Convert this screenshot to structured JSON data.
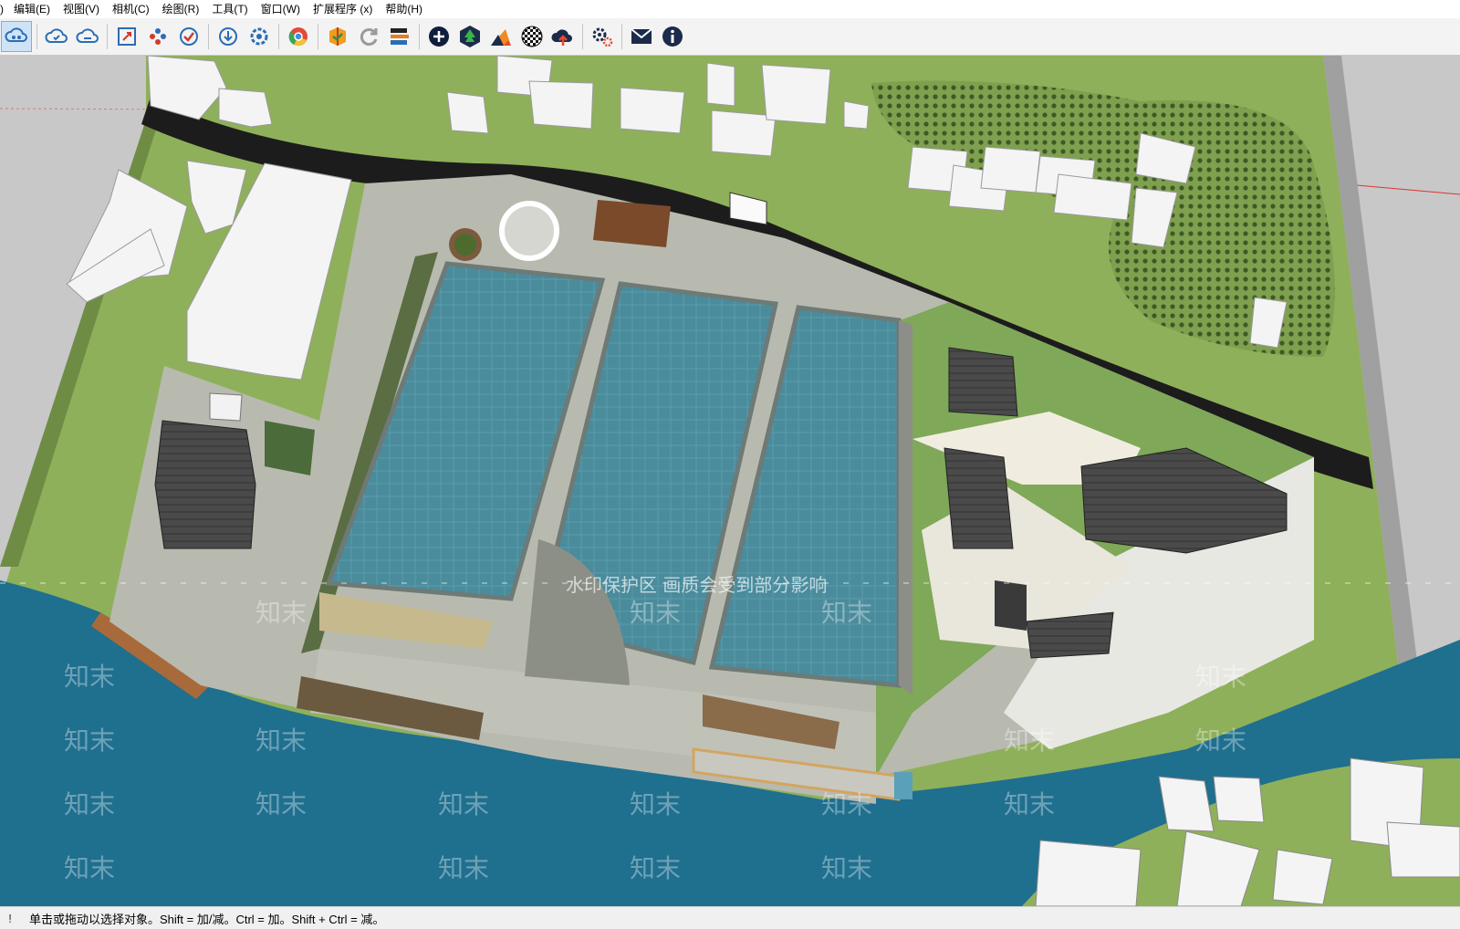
{
  "menu": {
    "first": ")",
    "items": [
      "编辑(E)",
      "视图(V)",
      "相机(C)",
      "绘图(R)",
      "工具(T)",
      "窗口(W)",
      "扩展程序 (x)",
      "帮助(H)"
    ]
  },
  "toolbar": {
    "icons": [
      "cloud-share-icon",
      "cloud-sync-icon",
      "cloud-upload-icon",
      "zoom-extents-icon",
      "components-icon",
      "validate-icon",
      "download-icon",
      "settings-icon",
      "chrome-icon",
      "extension-store-icon",
      "refresh-icon",
      "scene-export-icon",
      "add-icon",
      "tree-icon",
      "layers-icon",
      "checker-icon",
      "cloud-arrow-icon",
      "gear-icon",
      "mail-icon",
      "info-icon"
    ]
  },
  "viewport": {
    "watermark_notice": "水印保护区  画质会受到部分影响",
    "watermark_text": "知末"
  },
  "status": {
    "left_marker": "!",
    "message": "单击或拖动以选择对象。Shift = 加/减。Ctrl = 加。Shift + Ctrl = 减。"
  },
  "colors": {
    "sky": "#c8c8c8",
    "grass": "#8fb05a",
    "dark_green": "#3f6b2a",
    "water_pool": "#4e8f9f",
    "river": "#1f6f8f",
    "road": "#1c1c1c",
    "building": "#f4f4f4",
    "paving": "#b8bab0"
  }
}
